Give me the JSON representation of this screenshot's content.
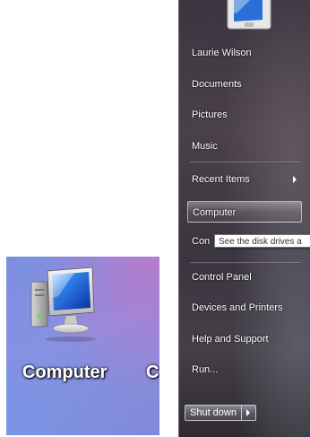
{
  "desktop": {
    "icon_label": "Computer",
    "next_icon_label_fragment": "C",
    "icon_name": "computer-monitor-icon"
  },
  "start_menu": {
    "items": [
      {
        "label": "Laurie Wilson",
        "has_arrow": false,
        "selected": false
      },
      {
        "label": "Documents",
        "has_arrow": false,
        "selected": false
      },
      {
        "label": "Pictures",
        "has_arrow": false,
        "selected": false
      },
      {
        "label": "Music",
        "has_arrow": false,
        "selected": false
      },
      {
        "label": "Recent Items",
        "has_arrow": true,
        "selected": false
      },
      {
        "label": "Computer",
        "has_arrow": false,
        "selected": true
      },
      {
        "label": "Con",
        "has_arrow": false,
        "selected": false
      },
      {
        "label": "Control Panel",
        "has_arrow": false,
        "selected": false
      },
      {
        "label": "Devices and Printers",
        "has_arrow": false,
        "selected": false
      },
      {
        "label": "Help and Support",
        "has_arrow": false,
        "selected": false
      },
      {
        "label": "Run...",
        "has_arrow": false,
        "selected": false
      }
    ],
    "tooltip": "See the disk drives a",
    "shutdown_label": "Shut down"
  },
  "colors": {
    "desktop_bg": "#7f8ad8",
    "menu_bg": "#3f3844",
    "menu_text": "#ffffff"
  }
}
